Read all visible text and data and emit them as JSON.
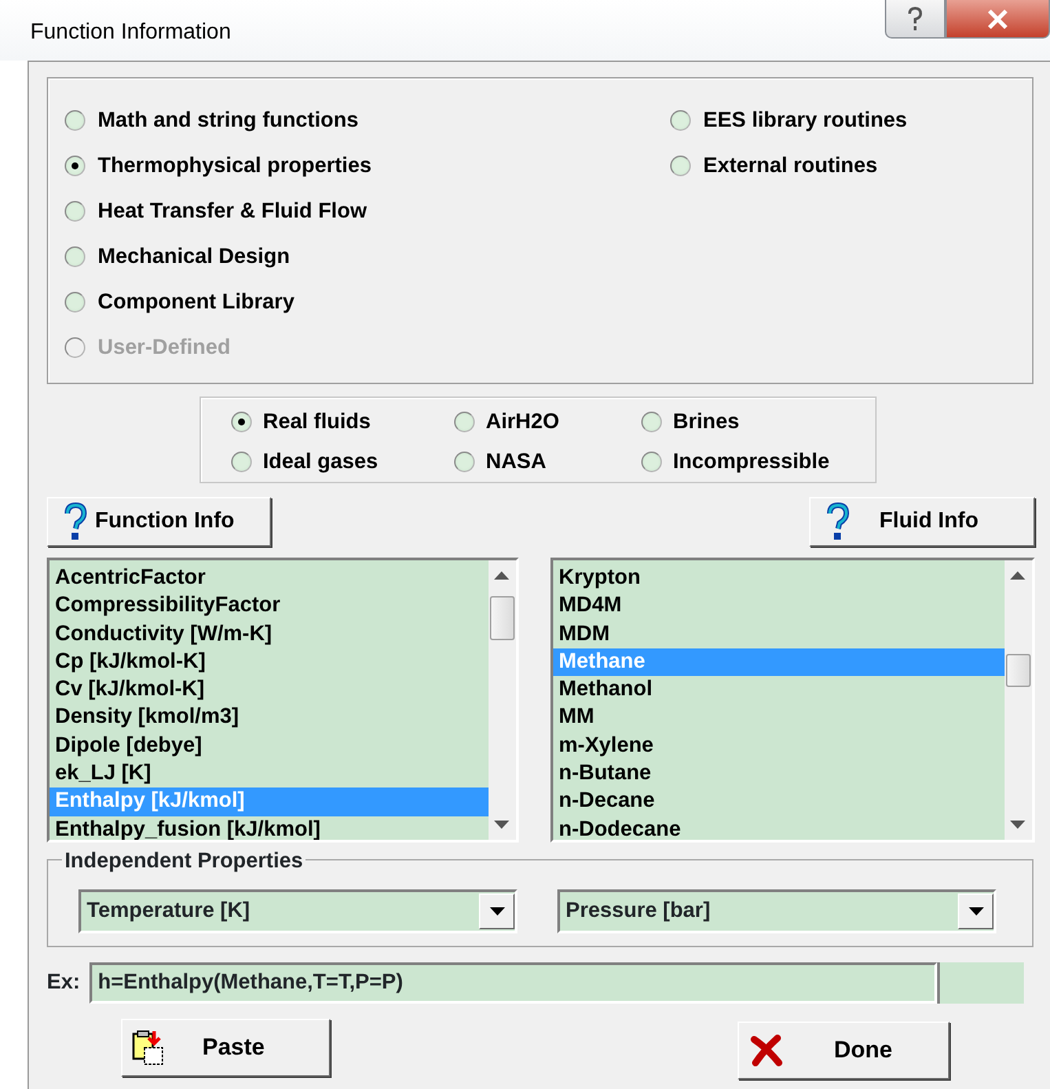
{
  "window": {
    "title": "Function Information"
  },
  "categories": [
    {
      "label": "Math and string functions",
      "selected": false,
      "disabled": false
    },
    {
      "label": "Thermophysical properties",
      "selected": true,
      "disabled": false
    },
    {
      "label": "Heat Transfer & Fluid Flow",
      "selected": false,
      "disabled": false
    },
    {
      "label": "Mechanical Design",
      "selected": false,
      "disabled": false
    },
    {
      "label": "Component Library",
      "selected": false,
      "disabled": false
    },
    {
      "label": "User-Defined",
      "selected": false,
      "disabled": true
    },
    {
      "label": "EES library routines",
      "selected": false,
      "disabled": false
    },
    {
      "label": "External routines",
      "selected": false,
      "disabled": false
    }
  ],
  "fluid_types": [
    {
      "label": "Real fluids",
      "selected": true
    },
    {
      "label": "Ideal gases",
      "selected": false
    },
    {
      "label": "AirH2O",
      "selected": false
    },
    {
      "label": "NASA",
      "selected": false
    },
    {
      "label": "Brines",
      "selected": false
    },
    {
      "label": "Incompressible",
      "selected": false
    }
  ],
  "info_buttons": [
    "Function Info",
    "Fluid Info"
  ],
  "function_list": [
    {
      "label": "AcentricFactor",
      "selected": false
    },
    {
      "label": "CompressibilityFactor",
      "selected": false
    },
    {
      "label": "Conductivity [W/m-K]",
      "selected": false
    },
    {
      "label": "Cp [kJ/kmol-K]",
      "selected": false
    },
    {
      "label": "Cv [kJ/kmol-K]",
      "selected": false
    },
    {
      "label": "Density [kmol/m3]",
      "selected": false
    },
    {
      "label": "Dipole [debye]",
      "selected": false
    },
    {
      "label": "ek_LJ [K]",
      "selected": false
    },
    {
      "label": "Enthalpy [kJ/kmol]",
      "selected": true
    },
    {
      "label": "Enthalpy_fusion [kJ/kmol]",
      "selected": false
    }
  ],
  "fluid_list": [
    {
      "label": "Krypton",
      "selected": false
    },
    {
      "label": "MD4M",
      "selected": false
    },
    {
      "label": "MDM",
      "selected": false
    },
    {
      "label": "Methane",
      "selected": true
    },
    {
      "label": "Methanol",
      "selected": false
    },
    {
      "label": "MM",
      "selected": false
    },
    {
      "label": "m-Xylene",
      "selected": false
    },
    {
      "label": "n-Butane",
      "selected": false
    },
    {
      "label": "n-Decane",
      "selected": false
    },
    {
      "label": "n-Dodecane",
      "selected": false
    }
  ],
  "independent_properties": {
    "legend": "Independent Properties",
    "selects": [
      "Temperature [K]",
      "Pressure [bar]"
    ]
  },
  "example": {
    "label": "Ex:",
    "value": "h=Enthalpy(Methane,T=T,P=P)"
  },
  "actions": [
    {
      "kind": "paste",
      "label": "Paste"
    },
    {
      "kind": "done",
      "label": "Done"
    }
  ]
}
